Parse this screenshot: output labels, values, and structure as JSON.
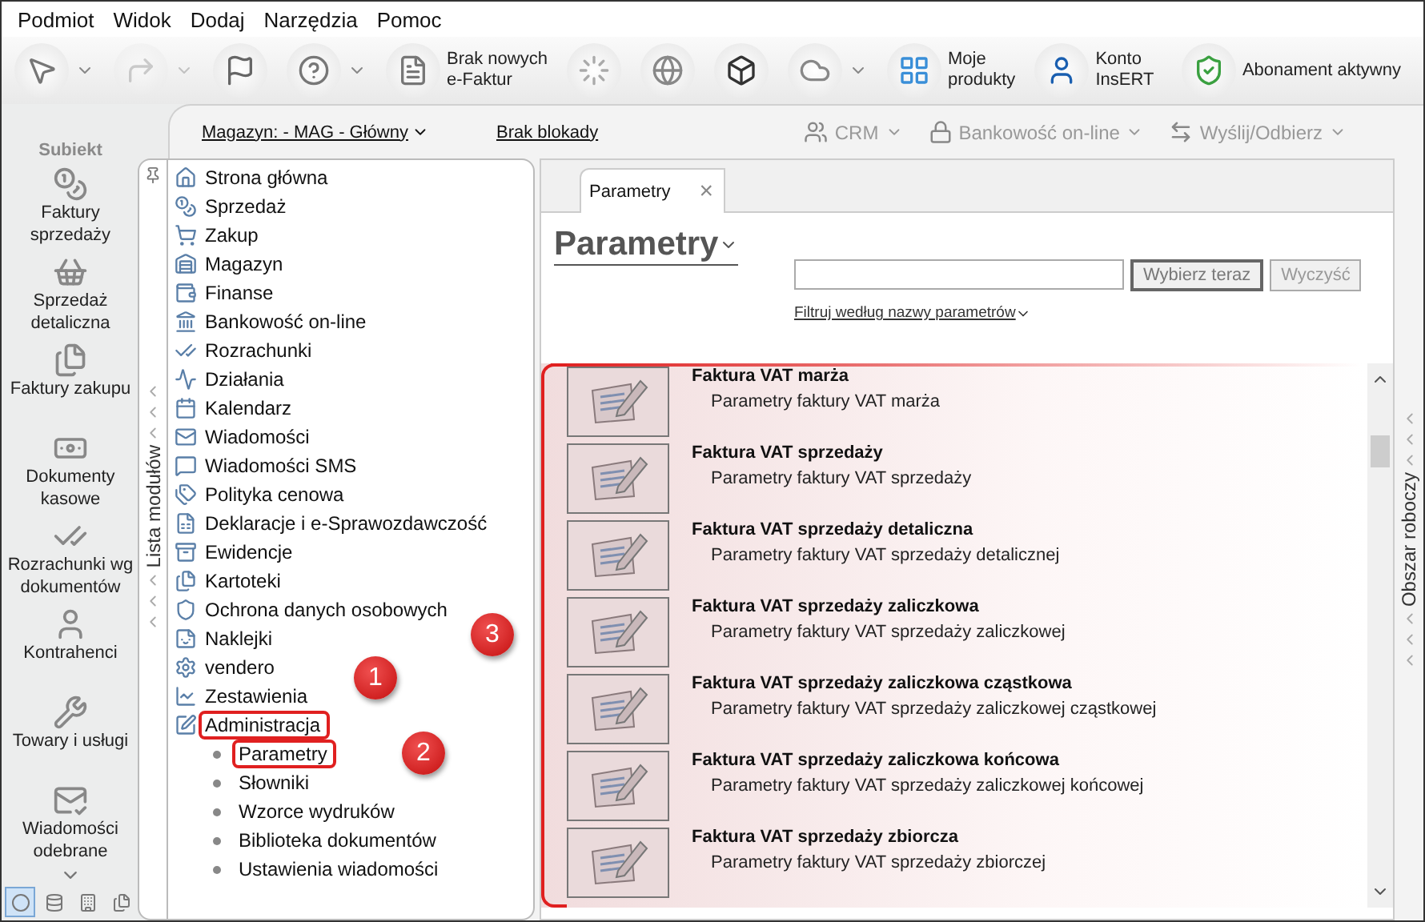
{
  "menu": [
    "Podmiot",
    "Widok",
    "Dodaj",
    "Narzędzia",
    "Pomoc"
  ],
  "toolbar": [
    {
      "dropdown": true,
      "disabled": false
    },
    {
      "dropdown": true,
      "disabled": true
    },
    {
      "dropdown": false,
      "disabled": false
    },
    {
      "dropdown": true,
      "disabled": false
    },
    {
      "label": "Brak nowych\ne-Faktur",
      "dropdown": false,
      "disabled": false
    },
    {
      "dropdown": false,
      "disabled": false
    },
    {
      "dropdown": false,
      "disabled": false
    },
    {
      "dropdown": false,
      "disabled": false
    },
    {
      "dropdown": true,
      "disabled": false
    },
    {
      "label": "Moje\nprodukty",
      "dropdown": false,
      "disabled": false
    },
    {
      "label": "Konto\nInsERT",
      "dropdown": false,
      "disabled": false
    },
    {
      "label": "Abonament aktywny",
      "dropdown": false,
      "disabled": false
    }
  ],
  "logo_text": "Subiekt",
  "subbar": {
    "warehouse": "Magazyn: - MAG - Główny",
    "lock": "Brak blokady",
    "actions": [
      {
        "label": "CRM",
        "disabled": true
      },
      {
        "label": "Bankowość on-line",
        "disabled": true
      },
      {
        "label": "Wyślij/Odbierz",
        "disabled": true
      }
    ]
  },
  "nav": [
    "Faktury\nsprzedaży",
    "Sprzedaż\ndetaliczna",
    "Faktury zakupu",
    "Dokumenty\nkasowe",
    "Rozrachunki wg\ndokumentów",
    "Kontrahenci",
    "Towary i usługi",
    "Wiadomości\nodebrane"
  ],
  "nav_bottom": [
    {
      "selected": true
    },
    {
      "selected": false
    },
    {
      "selected": false
    },
    {
      "selected": false
    }
  ],
  "modules": {
    "tab": "Lista modułów",
    "items": [
      {
        "label": "Strona główna"
      },
      {
        "label": "Sprzedaż"
      },
      {
        "label": "Zakup"
      },
      {
        "label": "Magazyn"
      },
      {
        "label": "Finanse"
      },
      {
        "label": "Bankowość on-line"
      },
      {
        "label": "Rozrachunki"
      },
      {
        "label": "Działania"
      },
      {
        "label": "Kalendarz"
      },
      {
        "label": "Wiadomości"
      },
      {
        "label": "Wiadomości SMS"
      },
      {
        "label": "Polityka cenowa"
      },
      {
        "label": "Deklaracje i e-Sprawozdawczość"
      },
      {
        "label": "Ewidencje"
      },
      {
        "label": "Kartoteki"
      },
      {
        "label": "Ochrona danych osobowych"
      },
      {
        "label": "Naklejki"
      },
      {
        "label": "vendero"
      },
      {
        "label": "Zestawienia"
      },
      {
        "label": "Administracja",
        "outlined": true,
        "marker": "1",
        "children": [
          {
            "label": "Parametry",
            "outlined": true,
            "marker": "2"
          },
          {
            "label": "Słowniki"
          },
          {
            "label": "Wzorce wydruków"
          },
          {
            "label": "Biblioteka dokumentów"
          },
          {
            "label": "Ustawienia wiadomości"
          }
        ]
      }
    ]
  },
  "tab": {
    "label": "Parametry",
    "close": "×"
  },
  "title": "Parametry",
  "search": {
    "button": {
      "label": "Wybierz teraz",
      "disabled": false
    },
    "clear": {
      "label": "Wyczyść",
      "disabled": true
    },
    "filter": "Filtruj według nazwy parametrów"
  },
  "results": {
    "outlined": true,
    "marker": "3",
    "rows": [
      {
        "title": "Faktura VAT marża",
        "description": "Parametry faktury VAT marża"
      },
      {
        "title": "Faktura VAT sprzedaży",
        "description": "Parametry faktury VAT sprzedaży"
      },
      {
        "title": "Faktura VAT sprzedaży detaliczna",
        "description": "Parametry faktury VAT sprzedaży detalicznej"
      },
      {
        "title": "Faktura VAT sprzedaży zaliczkowa",
        "description": "Parametry faktury VAT sprzedaży zaliczkowej"
      },
      {
        "title": "Faktura VAT sprzedaży zaliczkowa cząstkowa",
        "description": "Parametry faktury VAT sprzedaży zaliczkowej cząstkowej"
      },
      {
        "title": "Faktura VAT sprzedaży zaliczkowa końcowa",
        "description": "Parametry faktury VAT sprzedaży zaliczkowej końcowej"
      },
      {
        "title": "Faktura VAT sprzedaży zbiorcza",
        "description": "Parametry faktury VAT sprzedaży zbiorczej"
      }
    ]
  },
  "workspace_tab": "Obszar roboczy"
}
